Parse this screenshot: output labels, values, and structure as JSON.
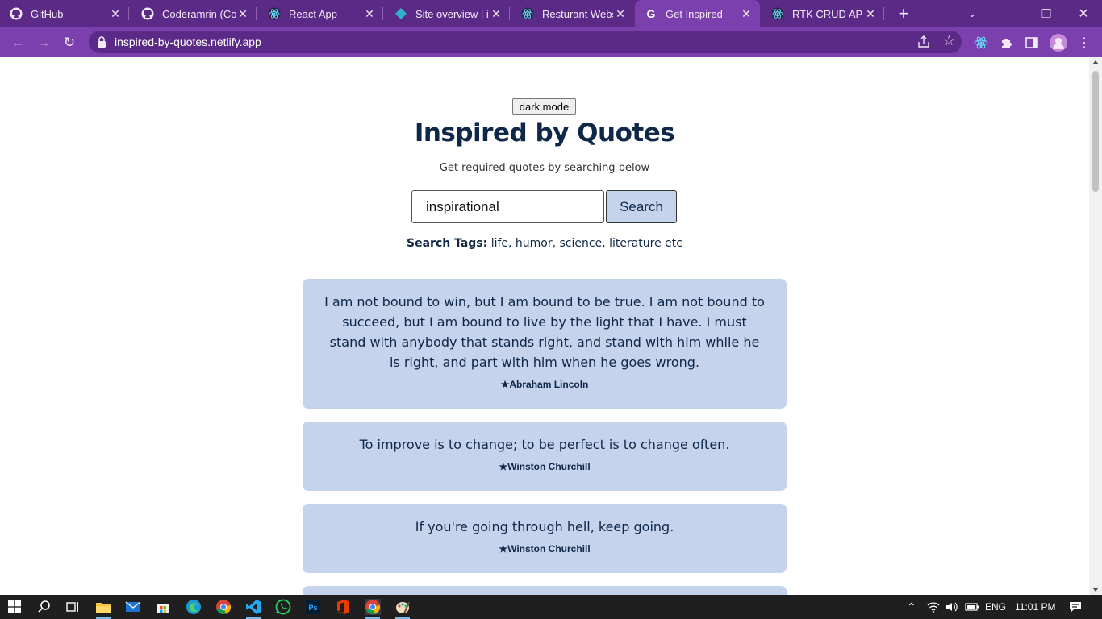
{
  "browser": {
    "tabs": [
      {
        "title": "GitHub",
        "icon": "github-icon"
      },
      {
        "title": "Coderamrin (Cod",
        "icon": "github-icon"
      },
      {
        "title": "React App",
        "icon": "react-icon"
      },
      {
        "title": "Site overview | in",
        "icon": "netlify-icon"
      },
      {
        "title": "Resturant Websit",
        "icon": "react-icon"
      },
      {
        "title": "Get Inspired",
        "icon": "google-icon",
        "active": true
      },
      {
        "title": "RTK CRUD APP",
        "icon": "react-icon"
      }
    ],
    "url": "inspired-by-quotes.netlify.app"
  },
  "page": {
    "dark_mode_label": "dark mode",
    "title": "Inspired by Quotes",
    "subtitle": "Get required quotes by searching below",
    "search": {
      "value": "inspirational",
      "button_label": "Search"
    },
    "tags": {
      "label": "Search Tags:",
      "list": "life, humor, science, literature etc"
    },
    "quotes": [
      {
        "text": "I am not bound to win, but I am bound to be true. I am not bound to succeed, but I am bound to live by the light that I have. I must stand with anybody that stands right, and stand with him while he is right, and part with him when he goes wrong.",
        "author": "★Abraham Lincoln"
      },
      {
        "text": "To improve is to change; to be perfect is to change often.",
        "author": "★Winston Churchill"
      },
      {
        "text": "If you're going through hell, keep going.",
        "author": "★Winston Churchill"
      }
    ]
  },
  "taskbar": {
    "language": "ENG",
    "time": "11:01 PM"
  },
  "colors": {
    "chrome_dark": "#5b2a86",
    "chrome_light": "#7b3fae",
    "card_bg": "#c5d3ec",
    "heading": "#0f2748"
  }
}
